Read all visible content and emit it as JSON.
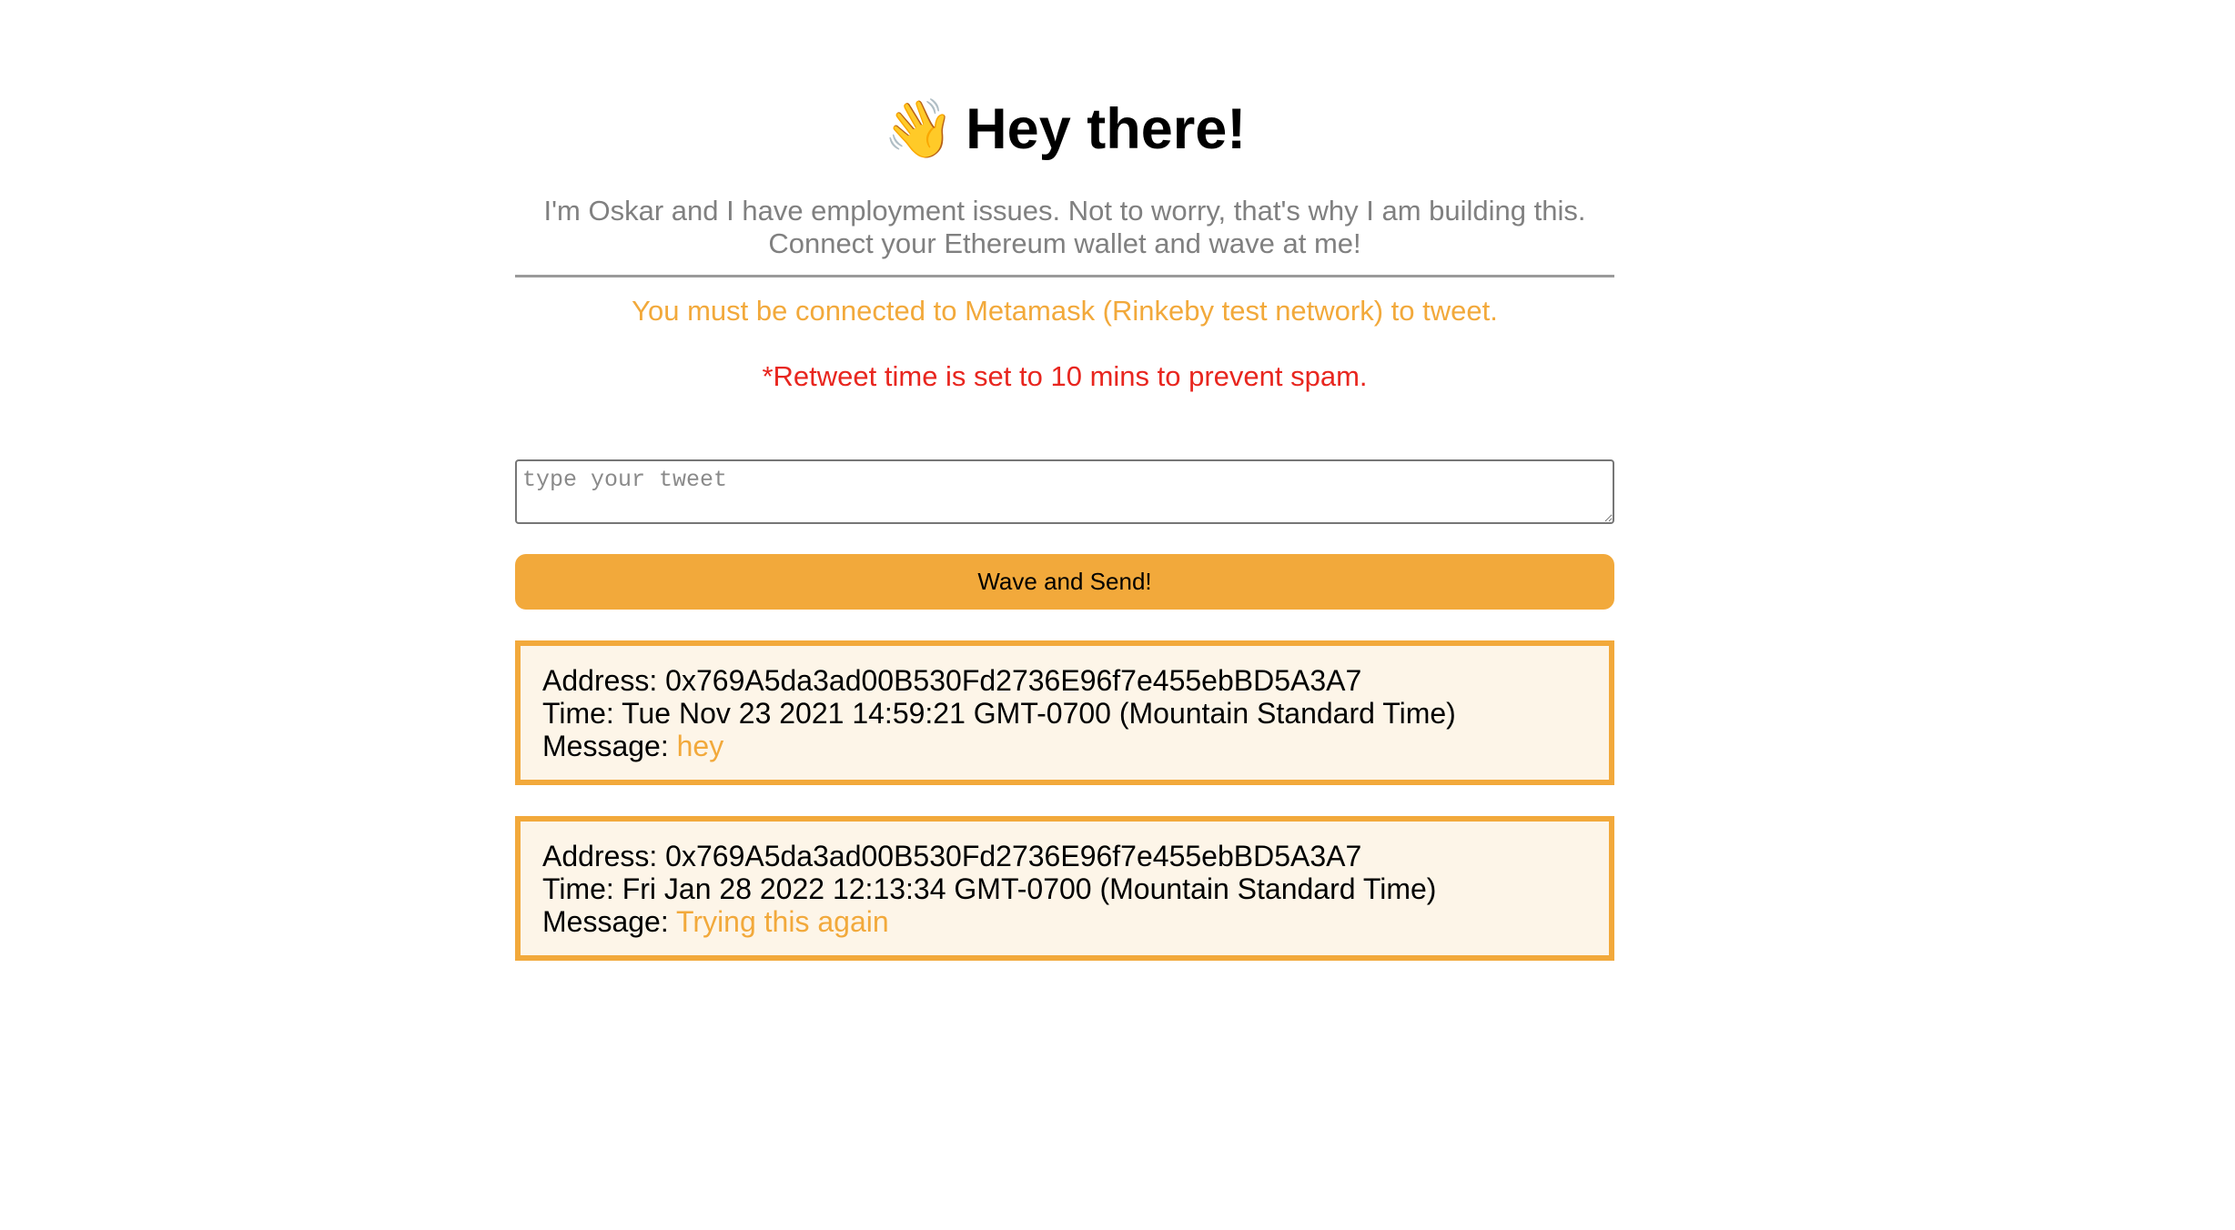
{
  "header": {
    "emoji": "👋",
    "title": "Hey there!"
  },
  "bio": "I'm Oskar and I have employment issues. Not to worry, that's why I am building this. Connect your Ethereum wallet and wave at me!",
  "notice": "You must be connected to Metamask (Rinkeby test network) to tweet.",
  "warning": "*Retweet time is set to 10 mins to prevent spam.",
  "tweet_input": {
    "placeholder": "type your tweet",
    "value": ""
  },
  "send_button": "Wave and Send!",
  "colors": {
    "accent": "#f2a93b",
    "card_bg": "#fdf5e8",
    "warning": "#e8261f"
  },
  "waves": [
    {
      "address_label": "Address: ",
      "address": "0x769A5da3ad00B530Fd2736E96f7e455ebBD5A3A7",
      "time_label": "Time: ",
      "time": "Tue Nov 23 2021 14:59:21 GMT-0700 (Mountain Standard Time)",
      "message_label": "Message: ",
      "message": "hey"
    },
    {
      "address_label": "Address: ",
      "address": "0x769A5da3ad00B530Fd2736E96f7e455ebBD5A3A7",
      "time_label": "Time: ",
      "time": "Fri Jan 28 2022 12:13:34 GMT-0700 (Mountain Standard Time)",
      "message_label": "Message: ",
      "message": "Trying this again"
    }
  ]
}
